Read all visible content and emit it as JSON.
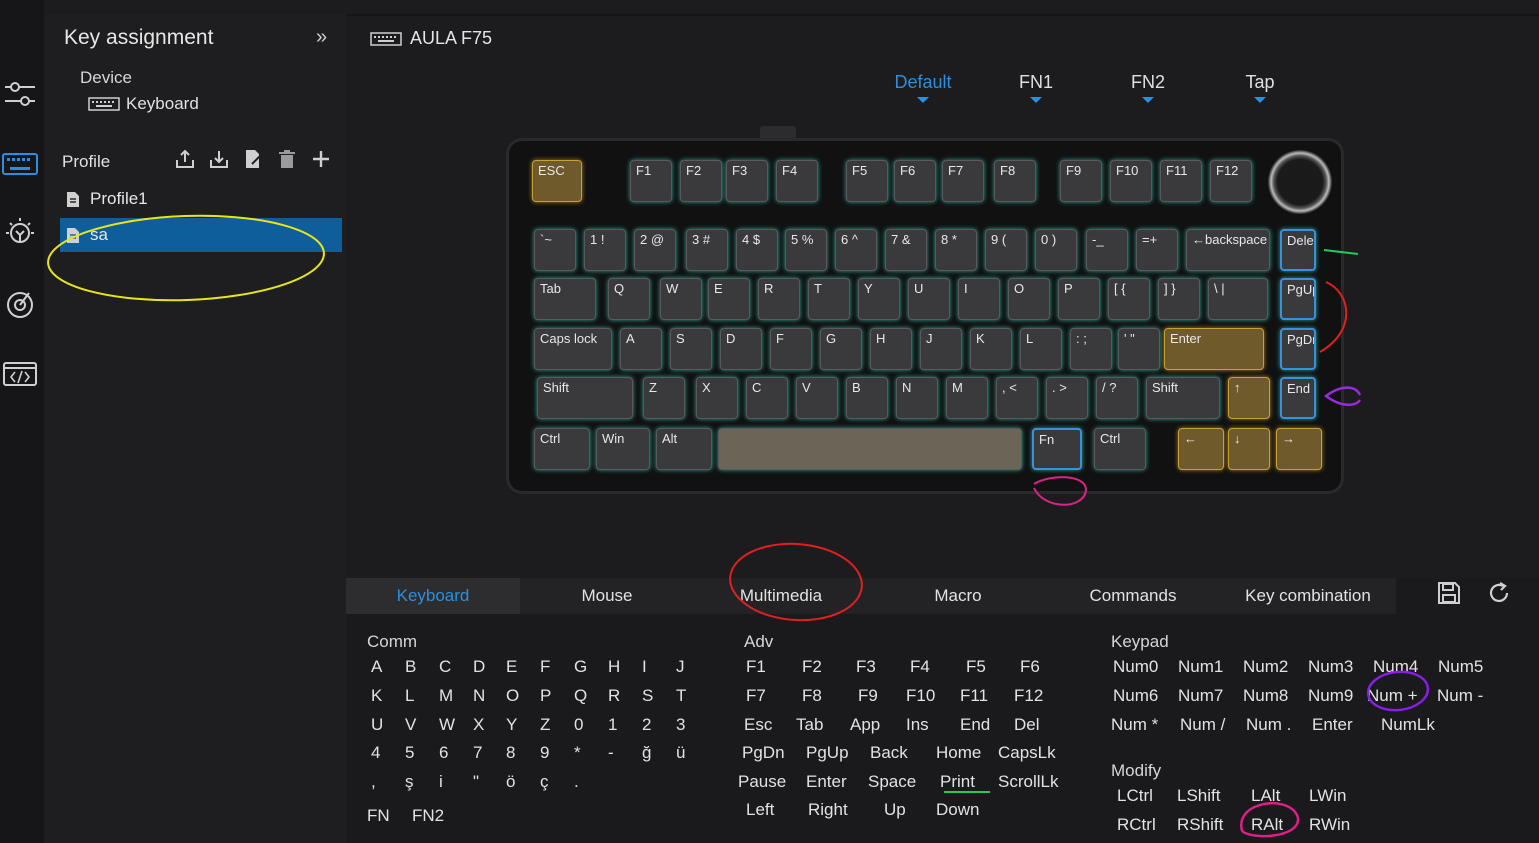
{
  "app": {
    "panel_title": "Key assignment",
    "device_label": "Device",
    "device_name": "Keyboard",
    "keyboard_model": "AULA F75"
  },
  "profiles": {
    "label": "Profile",
    "items": [
      "Profile1",
      "sa"
    ],
    "selected": "sa"
  },
  "layers": {
    "tabs": [
      "Default",
      "FN1",
      "FN2",
      "Tap"
    ],
    "active": "Default"
  },
  "keyboard": {
    "rows": [
      [
        "ESC",
        "F1",
        "F2",
        "F3",
        "F4",
        "F5",
        "F6",
        "F7",
        "F8",
        "F9",
        "F10",
        "F11",
        "F12"
      ],
      [
        "`~",
        "1 !",
        "2 @",
        "3 #",
        "4 $",
        "5 %",
        "6 ^",
        "7 &",
        "8 *",
        "9 (",
        "0 )",
        "-_",
        "=+",
        "←backspace",
        "Delete"
      ],
      [
        "Tab",
        "Q",
        "W",
        "E",
        "R",
        "T",
        "Y",
        "U",
        "I",
        "O",
        "P",
        "[ {",
        "] }",
        "\\ |",
        "PgUp"
      ],
      [
        "Caps lock",
        "A",
        "S",
        "D",
        "F",
        "G",
        "H",
        "J",
        "K",
        "L",
        ": ;",
        "' \"",
        "Enter",
        "PgDn"
      ],
      [
        "Shift",
        "Z",
        "X",
        "C",
        "V",
        "B",
        "N",
        "M",
        ", <",
        ". >",
        "/ ?",
        "Shift",
        "↑",
        "End"
      ],
      [
        "Ctrl",
        "Win",
        "Alt",
        "",
        "Fn",
        "Ctrl",
        "←",
        "↓",
        "→"
      ]
    ]
  },
  "bottom_tabs": {
    "items": [
      "Keyboard",
      "Mouse",
      "Multimedia",
      "Macro",
      "Commands",
      "Key combination"
    ],
    "active": "Keyboard"
  },
  "comm": {
    "title": "Comm",
    "rows": [
      [
        "A",
        "B",
        "C",
        "D",
        "E",
        "F",
        "G",
        "H",
        "I",
        "J"
      ],
      [
        "K",
        "L",
        "M",
        "N",
        "O",
        "P",
        "Q",
        "R",
        "S",
        "T"
      ],
      [
        "U",
        "V",
        "W",
        "X",
        "Y",
        "Z",
        "0",
        "1",
        "2",
        "3"
      ],
      [
        "4",
        "5",
        "6",
        "7",
        "8",
        "9",
        "*",
        "-",
        "ğ",
        "ü"
      ],
      [
        ",",
        "ş",
        "i",
        "\"",
        "ö",
        "ç",
        "."
      ],
      [
        "FN",
        "FN2"
      ]
    ]
  },
  "adv": {
    "title": "Adv",
    "rows": [
      [
        "F1",
        "F2",
        "F3",
        "F4",
        "F5",
        "F6"
      ],
      [
        "F7",
        "F8",
        "F9",
        "F10",
        "F11",
        "F12"
      ],
      [
        "Esc",
        "Tab",
        "App",
        "Ins",
        "End",
        "Del"
      ],
      [
        "PgDn",
        "PgUp",
        "Back",
        "Home",
        "CapsLk"
      ],
      [
        "Pause",
        "Enter",
        "Space",
        "Print",
        "ScrollLk"
      ],
      [
        "Left",
        "Right",
        "Up",
        "Down"
      ]
    ]
  },
  "keypad": {
    "title": "Keypad",
    "rows": [
      [
        "Num0",
        "Num1",
        "Num2",
        "Num3",
        "Num4",
        "Num5"
      ],
      [
        "Num6",
        "Num7",
        "Num8",
        "Num9",
        "Num +",
        "Num -"
      ],
      [
        "Num *",
        "Num /",
        "Num .",
        "Enter",
        "NumLk"
      ]
    ]
  },
  "modify": {
    "title": "Modify",
    "rows": [
      [
        "LCtrl",
        "LShift",
        "LAlt",
        "LWin"
      ],
      [
        "RCtrl",
        "RShift",
        "RAlt",
        "RWin"
      ]
    ]
  },
  "colors": {
    "accent": "#2a8fe0",
    "selected_row": "#0e5e9c",
    "background": "#1c1c1e"
  }
}
